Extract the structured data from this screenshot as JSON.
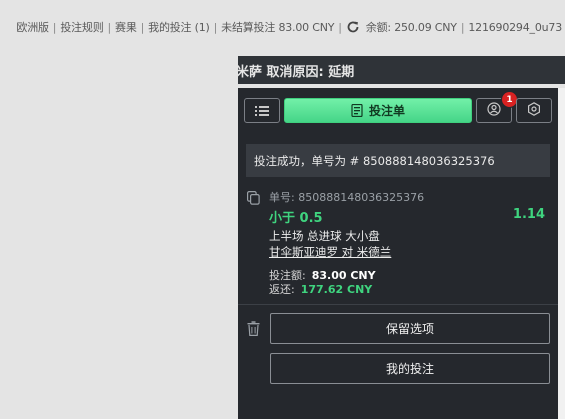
{
  "topbar": {
    "odds_format": "欧洲版",
    "rules": "投注规则",
    "results": "赛果",
    "my_bets": "我的投注 (1)",
    "unsettled": "未结算投注 83.00 CNY",
    "balance": "余额: 250.09 CNY",
    "account": "121690294_0u73"
  },
  "banner": {
    "text": "米萨 取消原因: 延期"
  },
  "toolbar": {
    "betslip_label": "投注单",
    "badge_count": "1"
  },
  "success": {
    "text": "投注成功，单号为 # 850888148036325376"
  },
  "bet": {
    "ticket_label": "单号: 850888148036325376",
    "selection": "小于 0.5",
    "odds": "1.14",
    "market": "上半场 总进球 大小盘",
    "match": "甘伞斯亚迪罗 对 米德兰",
    "stake_label": "投注额:",
    "stake_value": "83.00 CNY",
    "return_label": "返还:",
    "return_value": "177.62 CNY"
  },
  "actions": {
    "keep_label": "保留选项",
    "my_bets_label": "我的投注"
  },
  "colors": {
    "accent_green": "#3fd47f",
    "panel_bg": "#25282d",
    "badge_red": "#d92222"
  },
  "icons": [
    "refresh-icon",
    "list-icon",
    "betslip-icon",
    "account-icon",
    "settings-icon",
    "copy-icon",
    "trash-icon"
  ]
}
